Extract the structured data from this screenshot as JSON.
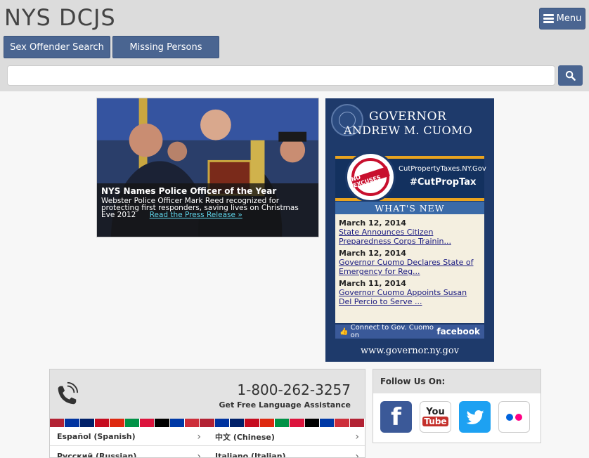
{
  "header": {
    "site_title": "NYS DCJS",
    "menu_label": "Menu",
    "nav": [
      {
        "label": "Sex Offender Search"
      },
      {
        "label": "Missing Persons"
      }
    ],
    "search": {
      "placeholder": "",
      "value": ""
    }
  },
  "feature": {
    "title": "NYS Names Police Officer of the Year",
    "text": "Webster Police Officer Mark Reed recognized for protecting first responders, saving lives on Christmas Eve 2012",
    "link": "Read the Press Release »"
  },
  "governor": {
    "line1": "GOVERNOR",
    "line2": "ANDREW M. CUOMO",
    "promo_url": "CutPropertyTaxes.NY.Gov",
    "promo_tag": "#CutPropTax",
    "whats_new_heading": "WHAT'S NEW",
    "news": [
      {
        "date": "March 12, 2014",
        "title": "State Announces Citizen Preparedness Corps Trainin..."
      },
      {
        "date": "March 12, 2014",
        "title": "Governor Cuomo Declares State of Emergency for Reg..."
      },
      {
        "date": "March 11, 2014",
        "title": "Governor Cuomo Appoints Susan Del Percio to Serve ..."
      }
    ],
    "connect_text": "Connect to Gov. Cuomo on",
    "connect_network": "facebook",
    "url": "www.governor.ny.gov"
  },
  "language": {
    "phone": "1-800-262-3257",
    "assist_text": "Get Free Language Assistance",
    "options": [
      {
        "label": "Español (Spanish)"
      },
      {
        "label": "中文 (Chinese)"
      },
      {
        "label": "Русский (Russian)"
      },
      {
        "label": "Italiano (Italian)"
      }
    ]
  },
  "follow": {
    "heading": "Follow Us On:",
    "networks": [
      {
        "name": "facebook",
        "glyph": "f"
      },
      {
        "name": "youtube",
        "glyph_top": "You",
        "glyph_bottom": "Tube"
      },
      {
        "name": "twitter"
      },
      {
        "name": "flickr"
      }
    ]
  },
  "colors": {
    "header_bg": "#dcdcdc",
    "button_bg": "#4a6591",
    "governor_bg": "#1e3a6b",
    "accent_orange": "#e9a31f",
    "facebook": "#3b5998",
    "twitter": "#1da1f2",
    "flickr_blue": "#0063dc",
    "flickr_pink": "#ff0084"
  }
}
